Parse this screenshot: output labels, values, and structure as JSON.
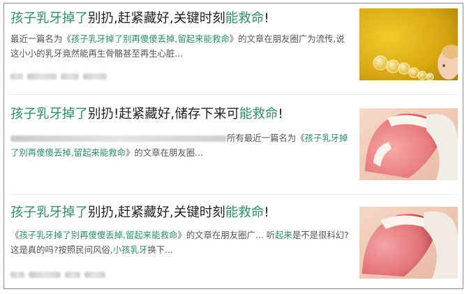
{
  "results": [
    {
      "title_parts": [
        {
          "text": "孩子乳牙掉了",
          "hl": true
        },
        {
          "text": "别扔,赶紧藏好,关键时刻",
          "hl": false
        },
        {
          "text": "能救命",
          "hl": true
        },
        {
          "text": "!",
          "hl": false
        }
      ],
      "summary_parts": [
        {
          "text": "最近一篇名为《",
          "hl": false
        },
        {
          "text": "孩子乳牙掉了别再傻傻丢掉,留起来能救命",
          "hl": true
        },
        {
          "text": "》的文章在朋友圈广为流传,说这小小的乳牙竟然能再生骨骼甚至再生心脏...",
          "hl": false
        }
      ],
      "thumbnail_icon": "baby-blowing-bubbles-photo"
    },
    {
      "title_parts": [
        {
          "text": "孩子乳牙掉了",
          "hl": true
        },
        {
          "text": "别扔!赶紧藏好,储存下来可",
          "hl": false
        },
        {
          "text": "能救命",
          "hl": true
        },
        {
          "text": "!",
          "hl": false
        }
      ],
      "summary_parts": [
        {
          "text": "所有最近一篇名为《",
          "hl": false
        },
        {
          "text": "孩子乳牙掉了别再傻傻丢掉,留起来能救命",
          "hl": true
        },
        {
          "text": "》的文章在朋友圈...",
          "hl": false
        }
      ],
      "thumbnail_icon": "child-mouth-teeth-photo"
    },
    {
      "title_parts": [
        {
          "text": "孩子乳牙掉了",
          "hl": true
        },
        {
          "text": "别扔,赶紧藏好,关键时刻",
          "hl": false
        },
        {
          "text": "能救命",
          "hl": true
        },
        {
          "text": "!",
          "hl": false
        }
      ],
      "summary_parts": [
        {
          "text": "《",
          "hl": false
        },
        {
          "text": "孩子乳牙掉了别再傻傻丢掉,留起来能救命",
          "hl": true
        },
        {
          "text": "》的文章在朋友圈广... 听",
          "hl": false
        },
        {
          "text": "起来",
          "hl": true
        },
        {
          "text": "是不是很科幻?这是真的吗?按照民间风俗,",
          "hl": false
        },
        {
          "text": "小孩乳牙",
          "hl": true
        },
        {
          "text": "换下...",
          "hl": false
        }
      ],
      "thumbnail_icon": "child-mouth-teeth-photo"
    }
  ],
  "colors": {
    "highlight": "#2f8c6d",
    "text": "#222222",
    "summary": "#555555",
    "border": "#8a8a8a"
  }
}
